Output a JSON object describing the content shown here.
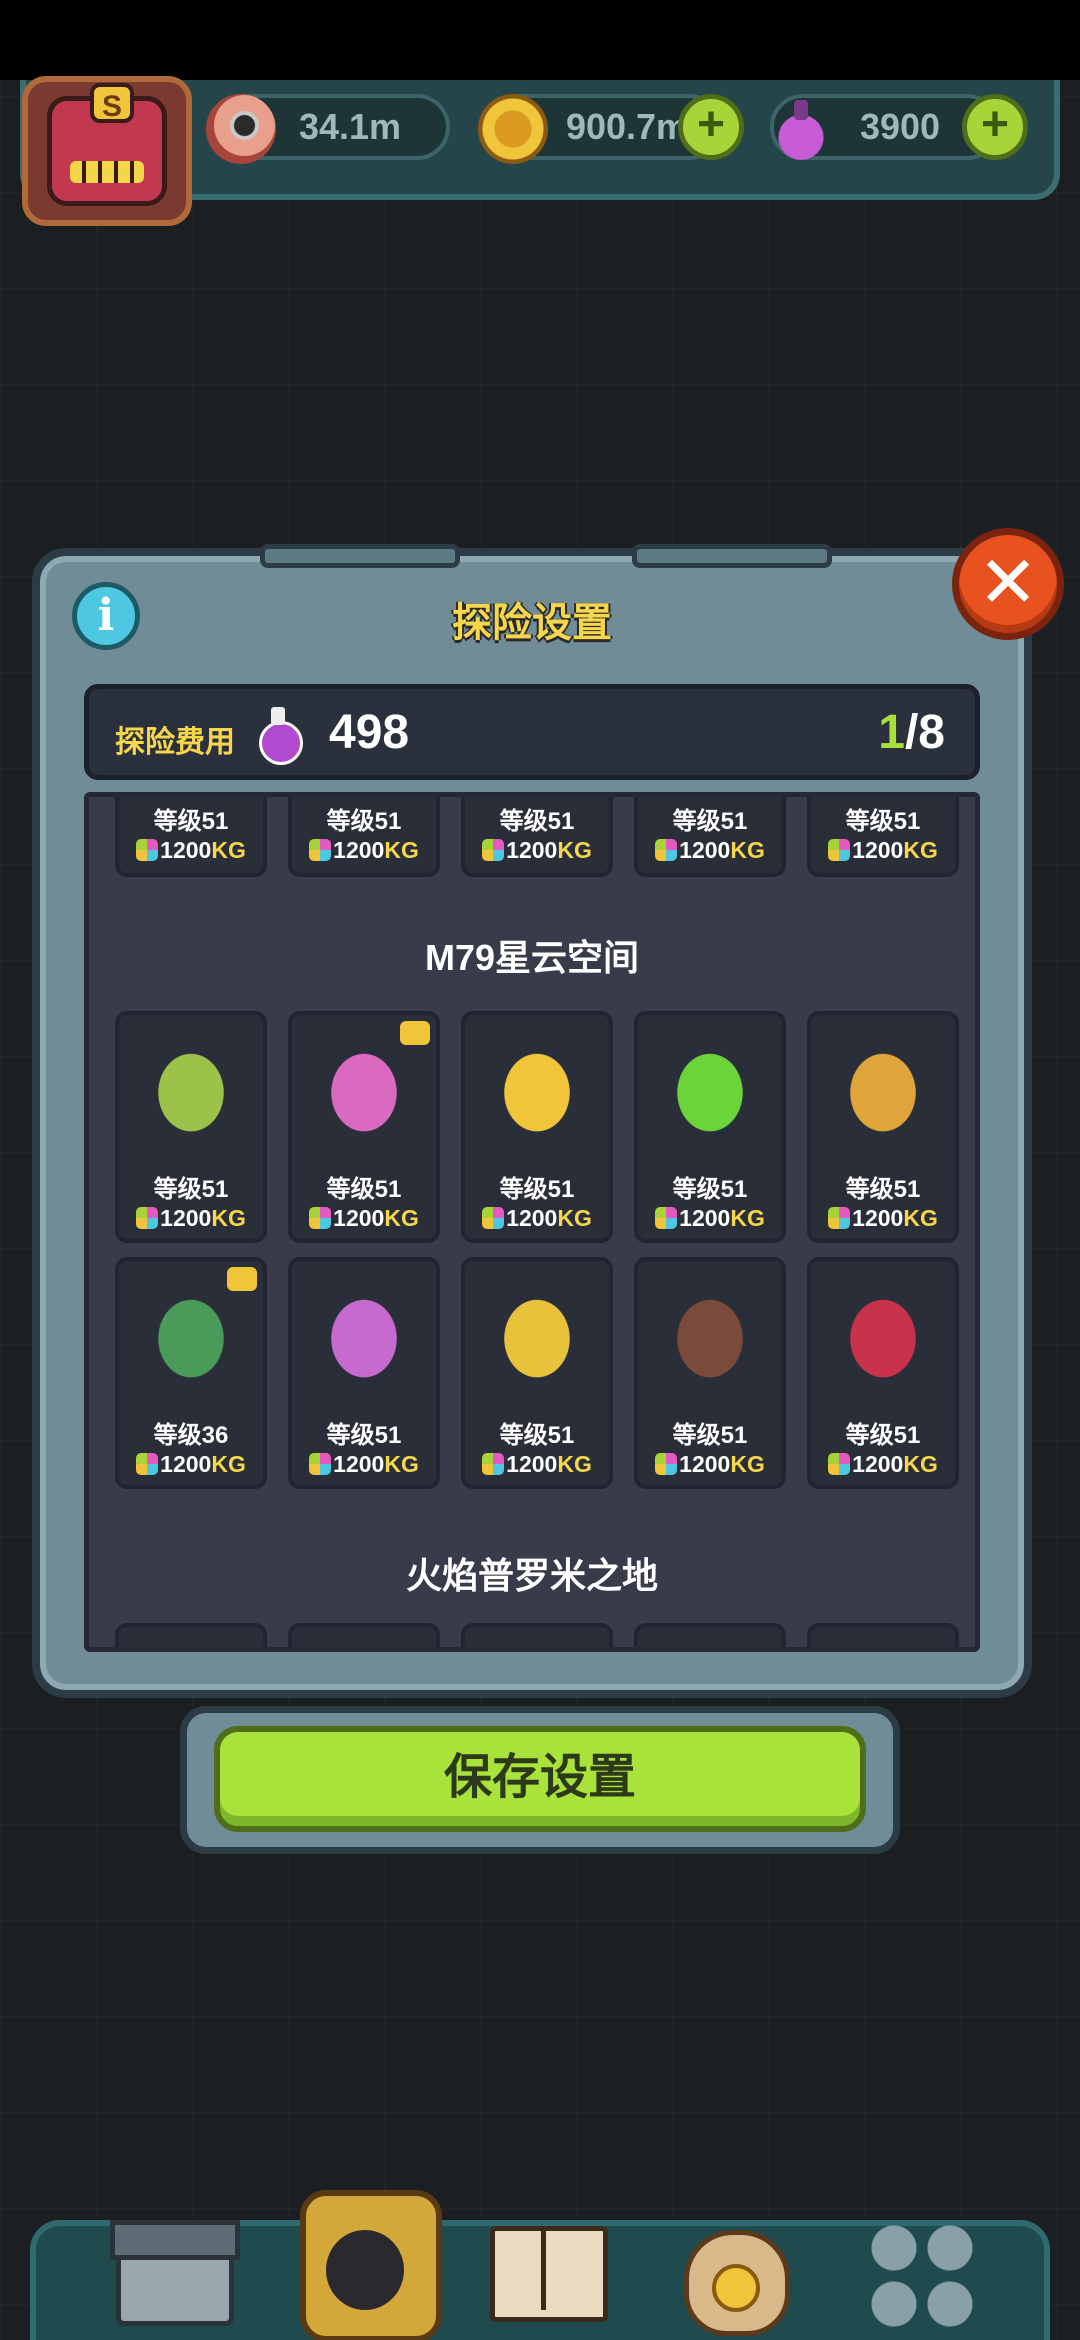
{
  "resources": {
    "eyes": "34.1m",
    "coins": "900.7m",
    "potions": "3900",
    "avatar_letter": "S"
  },
  "dialog": {
    "title": "探险设置",
    "info_label": "i",
    "close_label": "✕",
    "cost_label": "探险费用",
    "cost_value": "498",
    "count_current": "1",
    "count_rest": "/8"
  },
  "sections": {
    "top_row": [
      {
        "level": "等级51",
        "price": "1200",
        "unit": "KG"
      },
      {
        "level": "等级51",
        "price": "1200",
        "unit": "KG"
      },
      {
        "level": "等级51",
        "price": "1200",
        "unit": "KG"
      },
      {
        "level": "等级51",
        "price": "1200",
        "unit": "KG"
      },
      {
        "level": "等级51",
        "price": "1200",
        "unit": "KG"
      }
    ],
    "nebula_title": "M79星云空间",
    "nebula": [
      {
        "name": "green-egg-monster",
        "level": "等级51",
        "price": "1200",
        "unit": "KG",
        "color": "#9cc24a"
      },
      {
        "name": "pink-bush-monster",
        "level": "等级51",
        "price": "1200",
        "unit": "KG",
        "color": "#d96ac0"
      },
      {
        "name": "yellow-bee-monster",
        "level": "等级51",
        "price": "1200",
        "unit": "KG",
        "color": "#f0c53a"
      },
      {
        "name": "green-helmet-robot",
        "level": "等级51",
        "price": "1200",
        "unit": "KG",
        "color": "#6ad43a"
      },
      {
        "name": "cone-monster",
        "level": "等级51",
        "price": "1200",
        "unit": "KG",
        "color": "#e0a53a"
      },
      {
        "name": "green-frankenstein-monster",
        "level": "等级36",
        "price": "1200",
        "unit": "KG",
        "color": "#4a9a5a"
      },
      {
        "name": "jellyfish-bulb-monster",
        "level": "等级51",
        "price": "1200",
        "unit": "KG",
        "color": "#c66ad0"
      },
      {
        "name": "caterpillar-monster",
        "level": "等级51",
        "price": "1200",
        "unit": "KG",
        "color": "#e8c23a"
      },
      {
        "name": "chocolate-blob-monster",
        "level": "等级51",
        "price": "1200",
        "unit": "KG",
        "color": "#7a4a3a"
      },
      {
        "name": "red-spiral-monster",
        "level": "等级51",
        "price": "1200",
        "unit": "KG",
        "color": "#c8324a"
      }
    ],
    "fire_title": "火焰普罗米之地"
  },
  "save_label": "保存设置"
}
